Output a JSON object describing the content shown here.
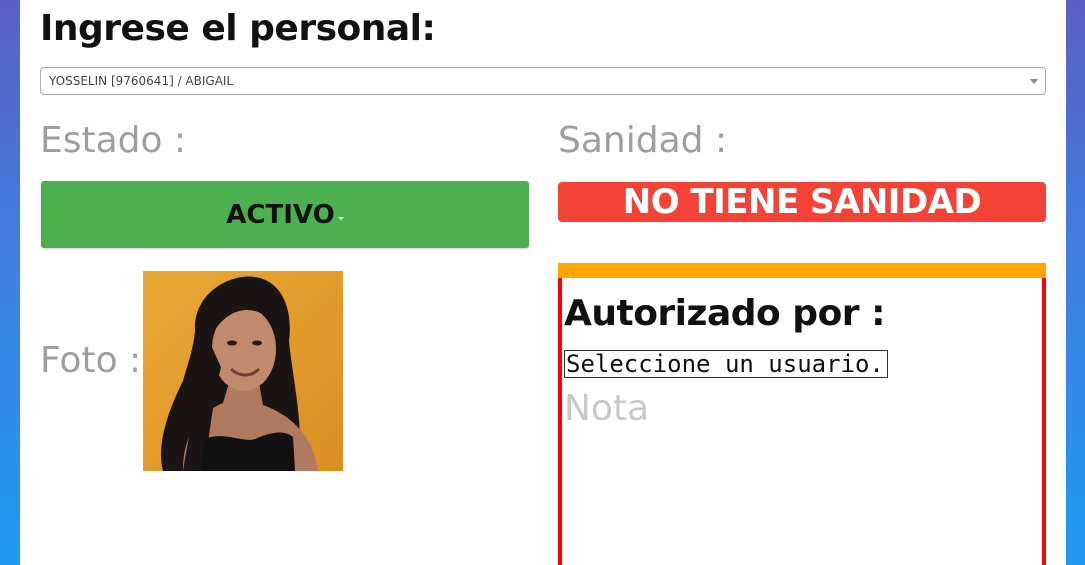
{
  "page": {
    "title": "Ingrese el personal:"
  },
  "personal_select": {
    "value": "YOSSELIN [9760641] / ABIGAIL",
    "icon": "chevron-down-icon"
  },
  "estado": {
    "label": "Estado :",
    "value": "ACTIVO",
    "color": "#4caf50"
  },
  "sanidad": {
    "label": "Sanidad :",
    "value": "NO TIENE SANIDAD",
    "color": "#f44336"
  },
  "foto": {
    "label": "Foto :"
  },
  "autorizacion": {
    "title": "Autorizado por :",
    "user_select_value": "Seleccione un usuario...",
    "nota_placeholder": "Nota",
    "border_color": "#ff0000",
    "accent_color": "#ffa500"
  }
}
